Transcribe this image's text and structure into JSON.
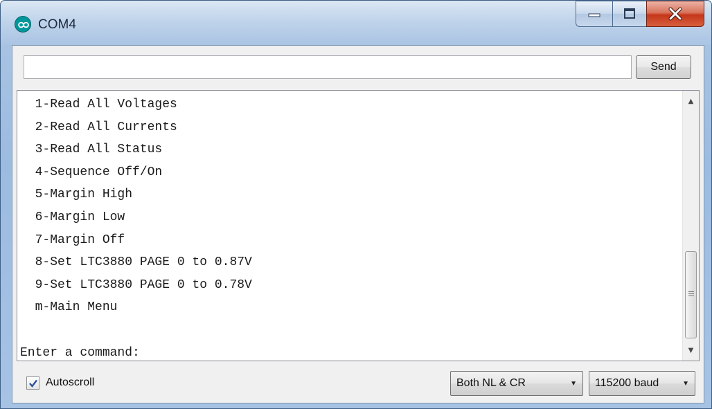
{
  "window": {
    "title": "COM4",
    "app_icon": "arduino-infinity-icon",
    "controls": {
      "minimize": "minimize-icon",
      "maximize": "maximize-icon",
      "close": "close-icon"
    }
  },
  "input": {
    "value": "",
    "placeholder": ""
  },
  "send_button": {
    "label": "Send"
  },
  "console": {
    "lines": [
      "  1-Read All Voltages",
      "  2-Read All Currents",
      "  3-Read All Status",
      "  4-Sequence Off/On",
      "  5-Margin High",
      "  6-Margin Low",
      "  7-Margin Off",
      "  8-Set LTC3880 PAGE 0 to 0.87V",
      "  9-Set LTC3880 PAGE 0 to 0.78V",
      "  m-Main Menu",
      "",
      "Enter a command:"
    ],
    "scroll_position": 0.78
  },
  "status": {
    "autoscroll_label": "Autoscroll",
    "autoscroll_checked": true,
    "line_ending": "Both NL & CR",
    "baud_rate": "115200 baud"
  },
  "colors": {
    "close_red": "#c5361a",
    "titlebar_blue": "#aac4e3"
  }
}
